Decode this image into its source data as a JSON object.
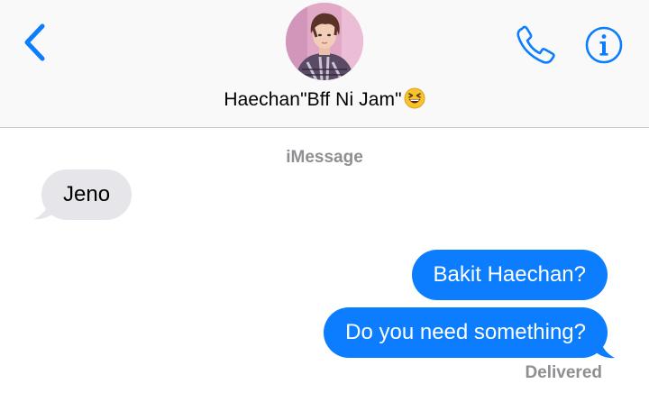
{
  "header": {
    "contact_name": "Haechan\"Bff Ni Jam\"",
    "emoji": "😆",
    "back_icon": "chevron-left-icon",
    "call_icon": "phone-icon",
    "info_icon": "info-icon",
    "accent_color": "#0b7dfe"
  },
  "conversation": {
    "service_label": "iMessage",
    "messages": [
      {
        "direction": "incoming",
        "text": "Jeno"
      },
      {
        "direction": "outgoing",
        "text": "Bakit Haechan?"
      },
      {
        "direction": "outgoing",
        "text": "Do you need something?"
      }
    ],
    "status": "Delivered",
    "incoming_color": "#e5e5ea",
    "outgoing_color": "#0b7dfe"
  }
}
